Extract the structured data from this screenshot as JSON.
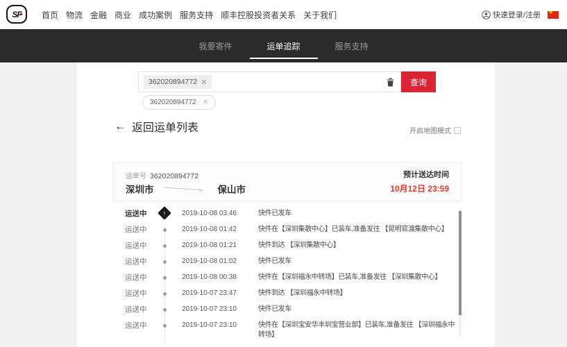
{
  "header": {
    "logo_text": "SF",
    "nav": [
      "首页",
      "物流",
      "金融",
      "商业",
      "成功案例",
      "服务支持",
      "顺丰控股投资者关系",
      "关于我们"
    ],
    "login_label": "快速登录/注册",
    "icons": {
      "login": "person-circle-icon",
      "flag": "china-flag-icon"
    }
  },
  "tabs": [
    {
      "label": "我要寄件",
      "active": false
    },
    {
      "label": "运单追踪",
      "active": true
    },
    {
      "label": "服务支持",
      "active": false
    }
  ],
  "search": {
    "chip_value": "362020894772",
    "query_button": "查询",
    "history_chip": "362020894772",
    "icons": {
      "clear": "trash-icon",
      "remove": "close-icon"
    }
  },
  "toolbar": {
    "back_label": "返回运单列表",
    "map_mode_label": "开启地图模式",
    "map_mode_checked": false
  },
  "waybill": {
    "number_label": "运单号",
    "number": "362020894772",
    "origin": "深圳市",
    "destination": "保山市",
    "eta_label": "预计送达时间",
    "eta_value": "10月12日 23:59"
  },
  "timeline": [
    {
      "status": "运送中",
      "time": "2019-10-08 03:46",
      "desc": "快件已发车",
      "current": true
    },
    {
      "status": "运送中",
      "time": "2019-10-08 01:42",
      "desc": "快件在【深圳集散中心】已装车,准备发往 【昆明官渡集散中心】",
      "current": false
    },
    {
      "status": "运送中",
      "time": "2019-10-08 01:21",
      "desc": "快件到达 【深圳集散中心】",
      "current": false
    },
    {
      "status": "运送中",
      "time": "2019-10-08 01:02",
      "desc": "快件已发车",
      "current": false
    },
    {
      "status": "运送中",
      "time": "2019-10-08 00:38",
      "desc": "快件在【深圳福永中转场】已装车,准备发往 【深圳集散中心】",
      "current": false
    },
    {
      "status": "运送中",
      "time": "2019-10-07 23:47",
      "desc": "快件到达 【深圳福永中转场】",
      "current": false
    },
    {
      "status": "运送中",
      "time": "2019-10-07 23:10",
      "desc": "快件已发车",
      "current": false
    },
    {
      "status": "运送中",
      "time": "2019-10-07 23:10",
      "desc": "快件在【深圳宝安华丰圳宝营业部】已装车,准备发往 【深圳福永中转场】",
      "current": false
    }
  ],
  "colors": {
    "accent_red": "#dc2334",
    "eta_red": "#f03227",
    "dark_bar": "#2b2b2b",
    "page_bg": "#f1f1f1"
  }
}
